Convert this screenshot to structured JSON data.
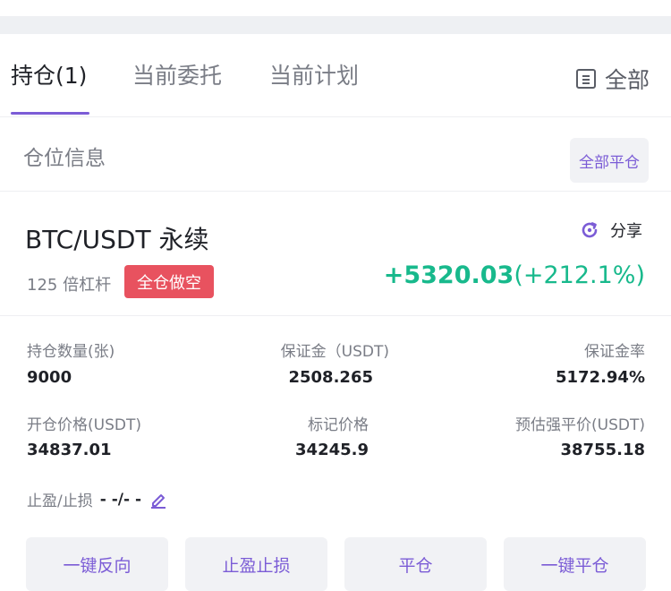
{
  "tabs": [
    {
      "label": "持仓(1)",
      "active": true
    },
    {
      "label": "当前委托",
      "active": false
    },
    {
      "label": "当前计划",
      "active": false
    }
  ],
  "filter": {
    "label": "全部",
    "icon": "list-icon"
  },
  "position_section": {
    "title": "仓位信息",
    "close_all_label": "全部平仓"
  },
  "card": {
    "symbol": "BTC/USDT 永续",
    "share_label": "分享",
    "share_icon": "share-icon",
    "leverage": "125 倍杠杆",
    "side_badge": "全仓做空",
    "pnl": "+5320.03",
    "pnl_percent": "(+212.1%)",
    "metrics": [
      {
        "label": "持仓数量(张)",
        "value": "9000"
      },
      {
        "label": "保证金（USDT)",
        "value": "2508.265"
      },
      {
        "label": "保证金率",
        "value": "5172.94%"
      },
      {
        "label": "开仓价格(USDT)",
        "value": "34837.01"
      },
      {
        "label": "标记价格",
        "value": "34245.9"
      },
      {
        "label": "预估强平价(USDT)",
        "value": "38755.18"
      }
    ],
    "tpsl_label": "止盈/止损",
    "tpsl_value": "- -/- -",
    "actions": [
      "一键反向",
      "止盈止损",
      "平仓",
      "一键平仓"
    ]
  },
  "colors": {
    "accent": "#7b5cd6",
    "profit": "#18b98c",
    "short": "#e8525f"
  }
}
